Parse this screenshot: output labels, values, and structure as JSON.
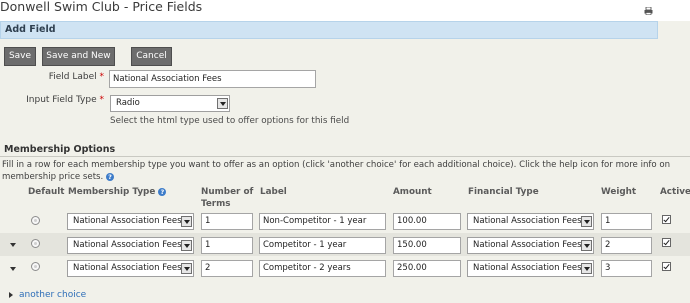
{
  "page": {
    "title": "Donwell Swim Club - Price Fields"
  },
  "panel": {
    "header": "Add Field"
  },
  "toolbar": {
    "save_label": "Save",
    "save_new_label": "Save and New",
    "cancel_label": "Cancel"
  },
  "form": {
    "field_label": {
      "label": "Field Label",
      "required_mark": "*",
      "value": "National Association Fees"
    },
    "input_type": {
      "label": "Input Field Type",
      "required_mark": "*",
      "value": "Radio",
      "help": "Select the html type used to offer options for this field"
    }
  },
  "membership": {
    "title": "Membership Options",
    "description": "Fill in a row for each membership type you want to offer as an option (click 'another choice' for each additional choice). Click the help icon for more info on membership price sets.",
    "columns": {
      "default": "Default",
      "membership_type": "Membership Type",
      "terms_line1": "Number of",
      "terms_line2": "Terms",
      "label": "Label",
      "amount": "Amount",
      "financial_type": "Financial Type",
      "weight": "Weight",
      "active": "Active"
    },
    "rows": [
      {
        "membership_type": "National Association Fees",
        "terms": "1",
        "label": "Non-Competitor - 1 year",
        "amount": "100.00",
        "financial_type": "National Association Fees",
        "weight": "1",
        "active": true
      },
      {
        "membership_type": "National Association Fees",
        "terms": "1",
        "label": "Competitor - 1 year",
        "amount": "150.00",
        "financial_type": "National Association Fees",
        "weight": "2",
        "active": true
      },
      {
        "membership_type": "National Association Fees",
        "terms": "2",
        "label": "Competitor - 2 years",
        "amount": "250.00",
        "financial_type": "National Association Fees",
        "weight": "3",
        "active": true
      }
    ],
    "another_choice": "another choice"
  },
  "icons": {
    "print": "print-icon",
    "help": "help-icon",
    "dropdown": "chevron-down-icon"
  }
}
